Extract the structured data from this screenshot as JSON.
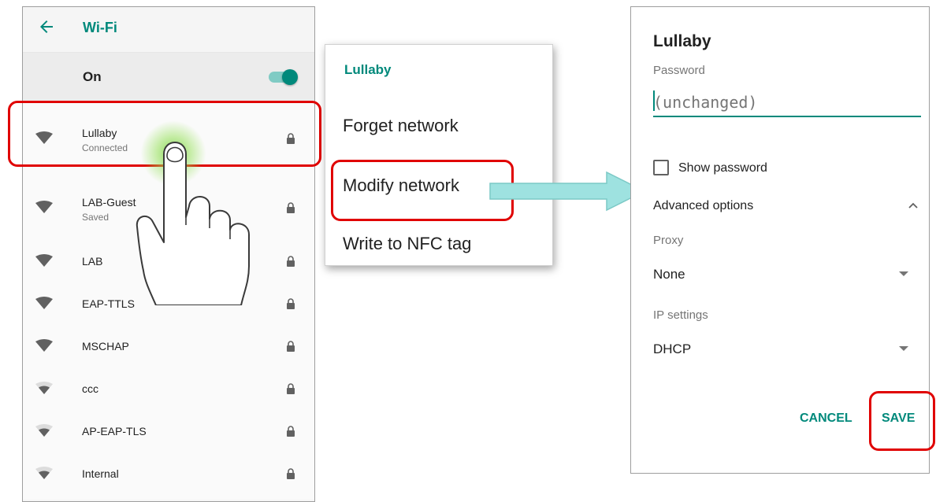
{
  "wifi_screen": {
    "title": "Wi-Fi",
    "toggle_label": "On",
    "toggle_state": "on",
    "networks": [
      {
        "name": "Lullaby",
        "status": "Connected",
        "signal": "full",
        "secured": true
      },
      {
        "name": "LAB-Guest",
        "status": "Saved",
        "signal": "full",
        "secured": true
      },
      {
        "name": "LAB",
        "status": "",
        "signal": "full",
        "secured": true
      },
      {
        "name": "EAP-TTLS",
        "status": "",
        "signal": "full",
        "secured": true
      },
      {
        "name": "MSCHAP",
        "status": "",
        "signal": "full",
        "secured": true
      },
      {
        "name": "ccc",
        "status": "",
        "signal": "medium",
        "secured": true
      },
      {
        "name": "AP-EAP-TLS",
        "status": "",
        "signal": "medium",
        "secured": true
      },
      {
        "name": "Internal",
        "status": "",
        "signal": "medium",
        "secured": true
      }
    ]
  },
  "context_menu": {
    "title": "Lullaby",
    "items": [
      "Forget network",
      "Modify network",
      "Write to NFC tag"
    ]
  },
  "dialog": {
    "title": "Lullaby",
    "password_label": "Password",
    "password_placeholder": "(unchanged)",
    "show_password_label": "Show password",
    "advanced_options_label": "Advanced options",
    "proxy_label": "Proxy",
    "proxy_value": "None",
    "ip_settings_label": "IP settings",
    "ip_settings_value": "DHCP",
    "cancel_label": "CANCEL",
    "save_label": "SAVE"
  },
  "colors": {
    "accent": "#00897b",
    "highlight": "#e00000",
    "arrow_fill": "#9ee2e0"
  }
}
